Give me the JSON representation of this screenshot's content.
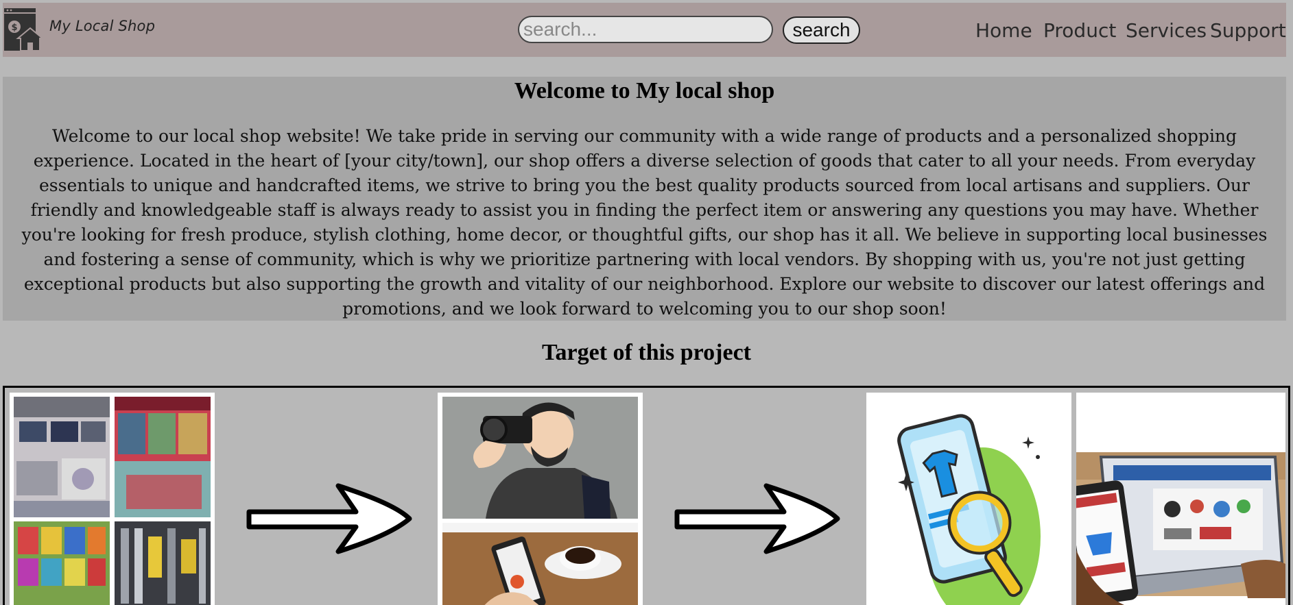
{
  "header": {
    "brand": "My Local Shop",
    "search_placeholder": "search...",
    "search_button": "search",
    "nav": [
      "Home",
      "Product",
      "Services",
      "Support"
    ]
  },
  "welcome": {
    "title": "Welcome to My local shop",
    "text": "Welcome to our local shop website! We take pride in serving our community with a wide range of products and a personalized shopping experience. Located in the heart of [your city/town], our shop offers a diverse selection of goods that cater to all your needs. From everyday essentials to unique and handcrafted items, we strive to bring you the best quality products sourced from local artisans and suppliers. Our friendly and knowledgeable staff is always ready to assist you in finding the perfect item or answering any questions you may have. Whether you're looking for fresh produce, stylish clothing, home decor, or thoughtful gifts, our shop has it all. We believe in supporting local businesses and fostering a sense of community, which is why we prioritize partnering with local vendors. By shopping with us, you're not just getting exceptional products but also supporting the growth and vitality of our neighborhood. Explore our website to discover our latest offerings and promotions, and we look forward to welcoming you to our shop soon!"
  },
  "target": {
    "title": "Target of this project"
  },
  "colors": {
    "header_bg": "#a99b9b",
    "page_bg": "#b8b8b8",
    "welcome_bg": "#a6a6a6"
  }
}
